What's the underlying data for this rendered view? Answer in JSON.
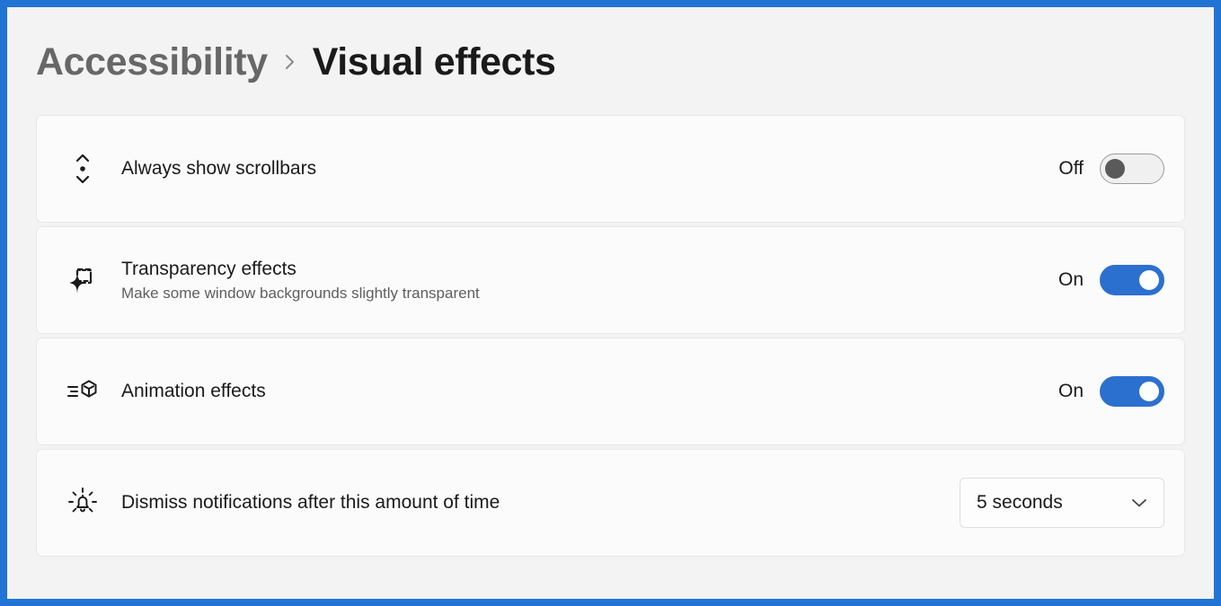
{
  "breadcrumb": {
    "parent": "Accessibility",
    "separator_icon": "chevron-right-icon",
    "current": "Visual effects"
  },
  "theme": {
    "accent_blue": "#2b70cf",
    "window_border_blue": "#2274d4",
    "page_background": "#f3f3f3",
    "card_background": "#fbfbfb",
    "card_border": "#e8e8e8",
    "title_color": "#1a1a1a",
    "description_color": "#5e5e5e",
    "breadcrumb_parent_color": "#676767",
    "toggle_off_knob": "#5a5a5a"
  },
  "settings": [
    {
      "id": "always-show-scrollbars",
      "icon": "scrollbar-icon",
      "title": "Always show scrollbars",
      "description": "",
      "control": "toggle",
      "state_label": "Off",
      "state_on": false
    },
    {
      "id": "transparency-effects",
      "icon": "transparency-icon",
      "title": "Transparency effects",
      "description": "Make some window backgrounds slightly transparent",
      "control": "toggle",
      "state_label": "On",
      "state_on": true
    },
    {
      "id": "animation-effects",
      "icon": "animation-icon",
      "title": "Animation effects",
      "description": "",
      "control": "toggle",
      "state_label": "On",
      "state_on": true
    },
    {
      "id": "dismiss-notifications",
      "icon": "notification-bell-icon",
      "title": "Dismiss notifications after this amount of time",
      "description": "",
      "control": "dropdown",
      "selected_value": "5 seconds",
      "dropdown_chevron_icon": "chevron-down-icon"
    }
  ]
}
